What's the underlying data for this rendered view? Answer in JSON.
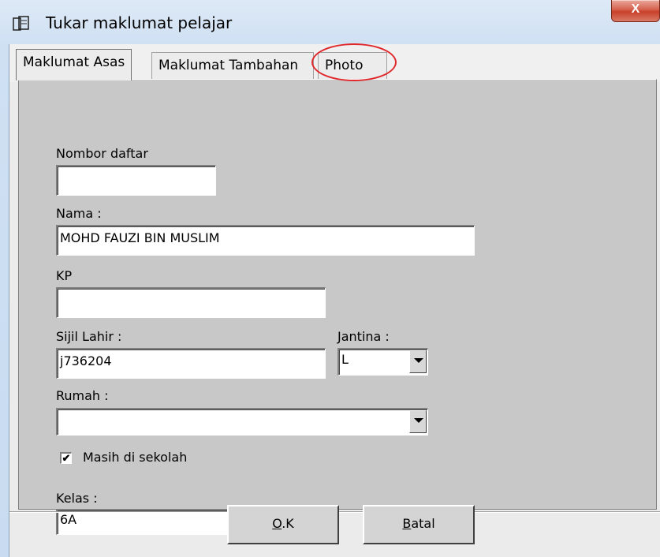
{
  "window": {
    "title": "Tukar maklumat pelajar",
    "close_label": "X"
  },
  "tabs": [
    {
      "label": "Maklumat Asas",
      "active": true
    },
    {
      "label": "Maklumat Tambahan",
      "active": false
    },
    {
      "label": "Photo",
      "active": false
    }
  ],
  "form": {
    "nombor_daftar_label": "Nombor daftar",
    "nombor_daftar_value": "",
    "nama_label": "Nama :",
    "nama_value": "MOHD FAUZI BIN MUSLIM",
    "kp_label": "KP",
    "kp_value": "",
    "sijil_lahir_label": "Sijil Lahir :",
    "sijil_lahir_value": "j736204",
    "jantina_label": "Jantina :",
    "jantina_value": "L",
    "rumah_label": "Rumah :",
    "rumah_value": "",
    "masih_label": "Masih di sekolah",
    "masih_checked": true,
    "check_mark": "✔",
    "kelas_label": "Kelas :",
    "kelas_value": "6A"
  },
  "buttons": {
    "ok_mnemonic": "O",
    "ok_rest": ".K",
    "batal_mnemonic": "B",
    "batal_rest": "atal"
  },
  "colors": {
    "highlight": "#e0282b",
    "close_button": "#c8402a"
  }
}
